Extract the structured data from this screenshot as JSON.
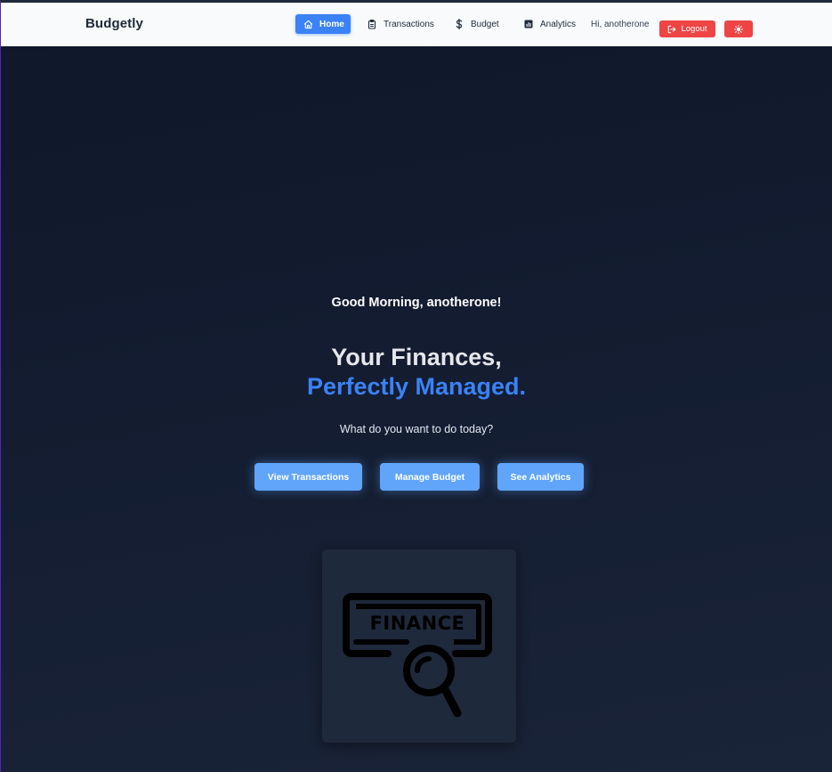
{
  "navbar": {
    "brand": "Budgetly",
    "items": [
      {
        "label": "Home",
        "icon": "home-icon",
        "active": true
      },
      {
        "label": "Transactions",
        "icon": "clipboard-icon",
        "active": false
      },
      {
        "label": "Budget",
        "icon": "dollar-icon",
        "active": false
      },
      {
        "label": "Analytics",
        "icon": "bar-chart-icon",
        "active": false
      }
    ],
    "greeting": "Hi, anotherone",
    "logout_label": "Logout",
    "theme_toggle_icon": "sun-icon"
  },
  "hero": {
    "greeting": "Good Morning, anotherone!",
    "headline_line1": "Your Finances,",
    "headline_line2": "Perfectly Managed.",
    "subtitle": "What do you want to do today?",
    "buttons": [
      {
        "label": "View Transactions"
      },
      {
        "label": "Manage Budget"
      },
      {
        "label": "See Analytics"
      }
    ]
  },
  "illustration": {
    "text": "FINANCE",
    "icon": "finance-search-icon"
  },
  "colors": {
    "accent": "#3b82f6",
    "cta": "#60a5fa",
    "danger": "#ef4444",
    "background": "#0f172a",
    "navbar": "#f8fafc",
    "card": "#1e293b"
  }
}
